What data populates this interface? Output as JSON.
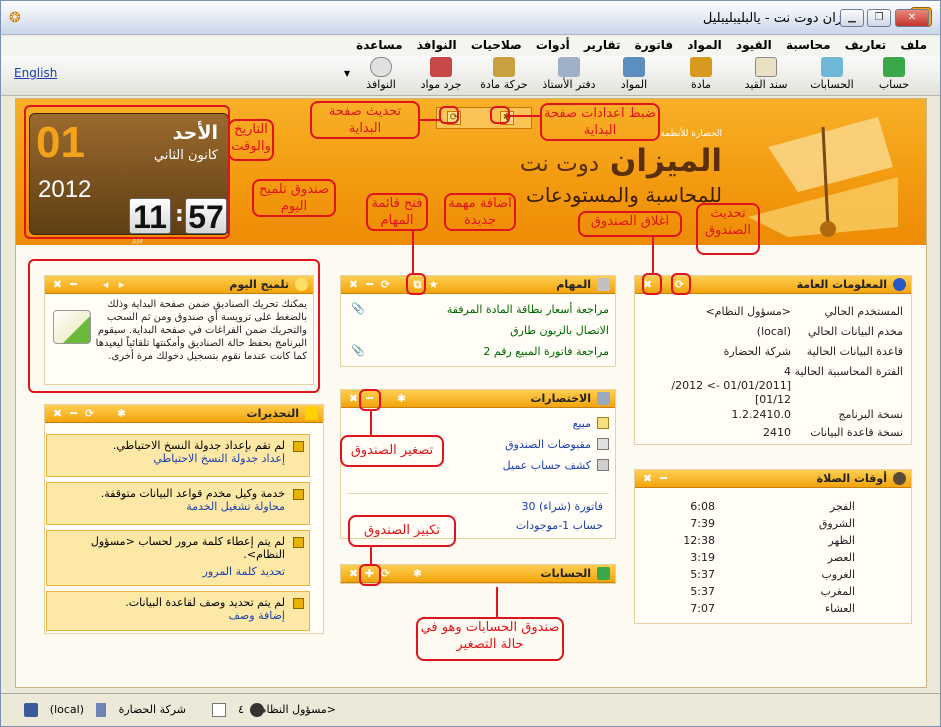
{
  "window": {
    "title": "الميزان دوت نت - يالبليبليبليل"
  },
  "menu": [
    "ملف",
    "تعاريف",
    "محاسبة",
    "القيود",
    "المواد",
    "فاتورة",
    "تقارير",
    "أدوات",
    "صلاحيات",
    "النوافذ",
    "مساعدة"
  ],
  "toolbar": {
    "items": [
      "حساب",
      "الحسابات",
      "سند القيد",
      "مادة",
      "المواد",
      "دفتر الأستاذ",
      "حركة مادة",
      "جرد مواد",
      "النوافذ"
    ],
    "language": "English"
  },
  "clock": {
    "day_number": "01",
    "day_name": "الأحد",
    "month": "كانون الثاني",
    "year": "2012",
    "hour": "11",
    "minute": "57",
    "ampm": "AM"
  },
  "logo": {
    "brand": "الميزان",
    "suffix": "دوت نت",
    "tagline": "للمحاسبة والمستودعات",
    "company": "الحضارة للأنظمة"
  },
  "tip": {
    "title": "تلميح اليوم",
    "text": "يمكنك تحريك الصناديق ضمن صفحة البداية وذلك بالضغط على ترويسة أي صندوق ومن ثم السحب والتحريك ضمن الفراغات في صفحة البداية. سيقوم البرنامج بحفظ حالة الصناديق وأمكنتها تلقائياً ليعيدها كما كانت عندما نقوم بتسجيل دخولك مرة أخرى."
  },
  "warnings": {
    "title": "التحذيرات",
    "items": [
      {
        "text": "لم تقم بإعداد جدولة النسخ الاحتياطي.",
        "link": "إعداد جدولة النسخ الاحتياطي"
      },
      {
        "text": "خدمة وكيل مخدم قواعد البيانات متوقفة.",
        "link": "محاولة تشغيل الخدمة"
      },
      {
        "text": "لم يتم إعطاء كلمة مرور لحساب <مسؤول النظام>.",
        "link": "تحديد كلمة المرور"
      },
      {
        "text": "لم يتم تحديد وصف لقاعدة البيانات.",
        "link": "إضافة وصف"
      }
    ]
  },
  "tasks": {
    "title": "المهام",
    "items": [
      "مراجعة أسعار بطاقة المادة المرفقة",
      "الاتصال بالزبون طارق",
      "مراجعة فاتورة المبيع رقم 2"
    ]
  },
  "shortcuts": {
    "title": "الاختصارات",
    "items": [
      "مبيع",
      "مقبوضات الصندوق",
      "كشف حساب عميل"
    ],
    "recent": [
      "فاتورة (شراء) 30",
      "حساب 1-موجودات"
    ]
  },
  "accounts": {
    "title": "الحسابات"
  },
  "general": {
    "title": "المعلومات العامة",
    "rows": [
      {
        "label": "المستخدم الحالي",
        "value": "<مسؤول النظام>"
      },
      {
        "label": "مخدم البيانات الحالي",
        "value": "(local)"
      },
      {
        "label": "قاعدة البيانات الحالية",
        "value": "شركة الحضارة"
      },
      {
        "label": "الفترة المحاسبية الحالية",
        "value": "4",
        "value2": "[01/01/2011 -> 2012/",
        "value3": "01/12]"
      },
      {
        "label": "نسخة البرنامج",
        "value": "1.2.2410.0"
      },
      {
        "label": "نسخة قاعدة البيانات",
        "value": "2410"
      }
    ]
  },
  "prayer": {
    "title": "أوقات الصلاة",
    "rows": [
      {
        "name": "الفجر",
        "time": "6:08"
      },
      {
        "name": "الشروق",
        "time": "7:39"
      },
      {
        "name": "الظهر",
        "time": "12:38"
      },
      {
        "name": "العصر",
        "time": "3:19"
      },
      {
        "name": "الغروب",
        "time": "5:37"
      },
      {
        "name": "المغرب",
        "time": "5:37"
      },
      {
        "name": "العشاء",
        "time": "7:07"
      }
    ]
  },
  "annotations": {
    "refresh_home": "تحديث صفحة البداية",
    "settings_home": "ضبط اعدادات صفحة البداية",
    "datetime": "التاريخ والوقت",
    "tip_box": "صندوق تلميح اليوم",
    "open_tasks": "فتح قائمة المهام",
    "add_task": "اضافة مهمة جديدة",
    "close_box": "اغلاق الصندوق",
    "refresh_box": "تحديث الصندوق",
    "minimize_box": "تصغير الصندوق",
    "maximize_box": "تكبير الصندوق",
    "accounts_min": "صندوق الحسابات وهو في حالة التصغير"
  },
  "status": {
    "user": "<مسؤول النظام>",
    "tasks_count": "٤",
    "company": "شركة الحضارة",
    "server": "(local)"
  }
}
